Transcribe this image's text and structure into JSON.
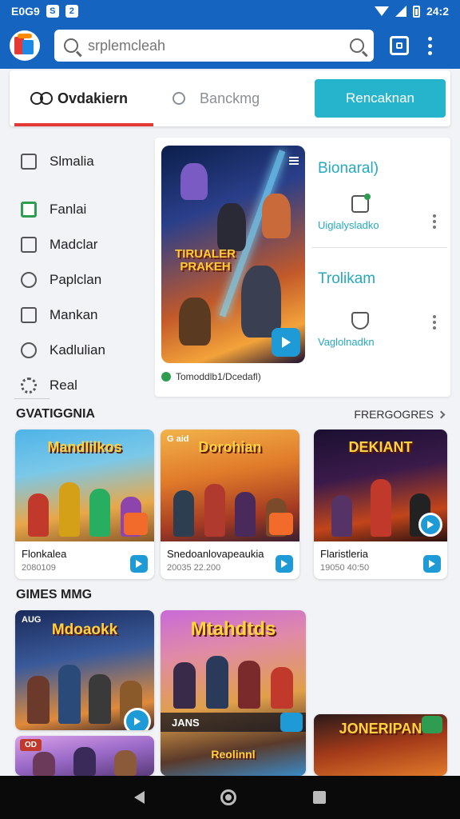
{
  "status": {
    "time": "E0G9",
    "badge1": "S",
    "badge2": "2",
    "clock": "24:2"
  },
  "search": {
    "placeholder": "srplemcleah",
    "value": ""
  },
  "tabs": [
    {
      "label": "Ovdakiern"
    },
    {
      "label": "Banckmg"
    }
  ],
  "tab_button": "Rencaknan",
  "sidebar": {
    "items": [
      {
        "label": "Slmalia",
        "icon": "book-icon"
      },
      {
        "label": "Fanlai",
        "icon": "flag-icon"
      },
      {
        "label": "Madclar",
        "icon": "image-icon"
      },
      {
        "label": "Paplclan",
        "icon": "search-refresh-icon"
      },
      {
        "label": "Mankan",
        "icon": "square-icon"
      },
      {
        "label": "Kadlulian",
        "icon": "circle-icon"
      },
      {
        "label": "Real",
        "icon": "gear-icon"
      }
    ]
  },
  "featured": {
    "title": "TIRUALER PRAKEH",
    "caption": "Tomoddlb1/Dcedafl)",
    "entries": [
      {
        "title": "Bionaral)",
        "sub": "Uiglalysladko"
      },
      {
        "title": "Trolikam",
        "sub": "Vaglolnadkn"
      }
    ]
  },
  "section1": {
    "title": "GVATIGGNIA",
    "see_all": "FRERGOGRES",
    "cards": [
      {
        "art_title": "Mandlilkos",
        "name": "Flonkalea",
        "meta": "2080109"
      },
      {
        "art_title": "Dorohian",
        "chip": "G aid",
        "name": "Snedoanlovapeaukia",
        "meta": "20035 22.200"
      },
      {
        "art_title": "DEKIANT",
        "name": "Flaristleria",
        "meta": "19050 40:50"
      }
    ]
  },
  "section2": {
    "title": "GIMES MMG",
    "cards": [
      {
        "art_title": "Mdoaokk",
        "chip": "AUG"
      },
      {
        "art_title": "Mtahdtds",
        "strip": "JANS"
      },
      {
        "art_title": "Reolinnl"
      },
      {
        "chip": "OD"
      },
      {
        "art_title": "JONERIPAN"
      }
    ]
  },
  "colors": {
    "brand": "#1565c0",
    "accent": "#26b3cc",
    "tab_underline": "#e53935",
    "badge": "#1e9bd7"
  }
}
